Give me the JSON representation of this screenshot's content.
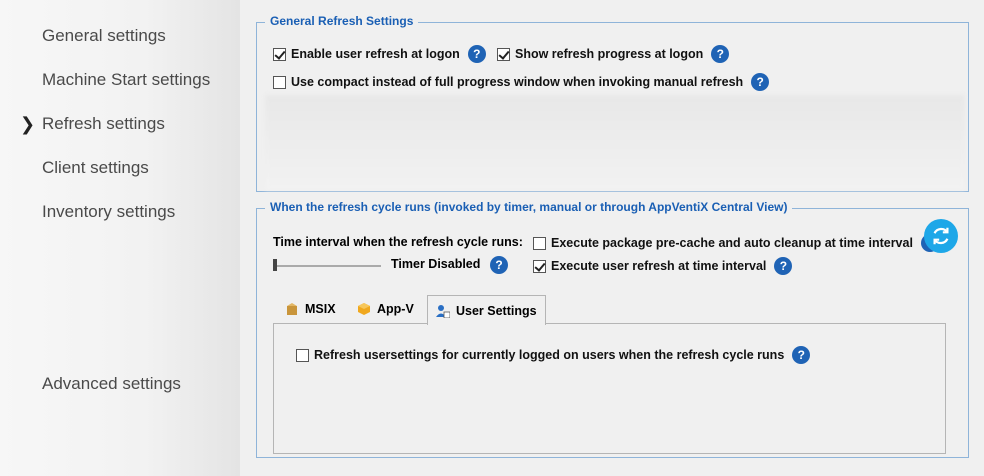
{
  "sidebar": {
    "items": [
      {
        "label": "General settings"
      },
      {
        "label": "Machine Start settings"
      },
      {
        "label": "Refresh settings",
        "active": true
      },
      {
        "label": "Client settings"
      },
      {
        "label": "Inventory settings"
      },
      {
        "label": "Advanced settings"
      }
    ],
    "active_marker": "❯"
  },
  "general_refresh": {
    "title": "General Refresh Settings",
    "enable_user_refresh": {
      "label": "Enable user refresh at logon",
      "checked": true
    },
    "show_refresh_progress": {
      "label": "Show refresh progress at logon",
      "checked": true
    },
    "use_compact": {
      "label": "Use compact instead of full progress window when invoking manual refresh",
      "checked": false
    }
  },
  "refresh_cycle": {
    "title": "When the refresh cycle runs (invoked by timer, manual or through AppVentiX Central View)",
    "time_interval_label": "Time interval when the refresh cycle runs:",
    "timer_value_label": "Timer Disabled",
    "timer_level": 0,
    "execute_precache": {
      "label": "Execute package pre-cache and auto cleanup at time interval",
      "checked": false
    },
    "execute_user_refresh": {
      "label": "Execute user refresh at time interval",
      "checked": true
    },
    "refresh_button_icon": "refresh-icon"
  },
  "tabs": [
    {
      "label": "MSIX",
      "icon": "package-icon"
    },
    {
      "label": "App-V",
      "icon": "appv-icon"
    },
    {
      "label": "User Settings",
      "icon": "user-settings-icon",
      "active": true
    }
  ],
  "user_settings_panel": {
    "refresh_usersettings": {
      "label": "Refresh usersettings for currently logged on users when the refresh cycle runs",
      "checked": false
    }
  },
  "help_glyph": "?",
  "colors": {
    "accent": "#1f63b5",
    "group_title": "#1a5fb4",
    "refresh_button": "#1ea7e8"
  }
}
